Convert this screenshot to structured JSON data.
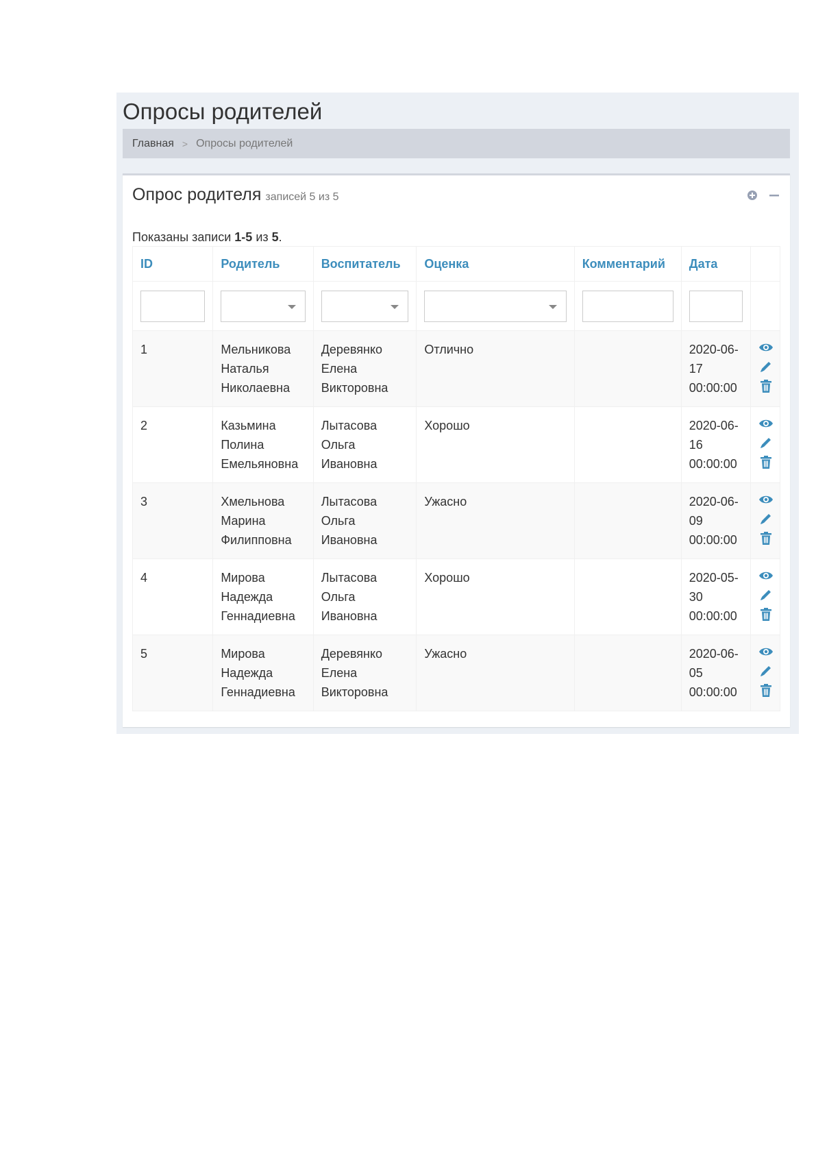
{
  "page_title": "Опросы родителей",
  "breadcrumb": {
    "home": "Главная",
    "separator": ">",
    "current": "Опросы родителей"
  },
  "box": {
    "title": "Опрос родителя",
    "count_text": "записей 5 из 5",
    "tools": [
      "plus-circle-icon",
      "minus-icon"
    ]
  },
  "summary": {
    "prefix": "Показаны записи ",
    "range": "1-5",
    "middle": " из ",
    "total": "5",
    "suffix": "."
  },
  "table": {
    "columns": [
      "ID",
      "Родитель",
      "Воспитатель",
      "Оценка",
      "Комментарий",
      "Дата"
    ],
    "rows": [
      {
        "id": "1",
        "parent": "Мельникова Наталья Николаевна",
        "teacher": "Деревянко Елена Викторовна",
        "rating": "Отлично",
        "comment": "",
        "date": "2020-06-17 00:00:00"
      },
      {
        "id": "2",
        "parent": "Казьмина Полина Емельяновна",
        "teacher": "Лытасова Ольга Ивановна",
        "rating": "Хорошо",
        "comment": "",
        "date": "2020-06-16 00:00:00"
      },
      {
        "id": "3",
        "parent": "Хмельнова Марина Филипповна",
        "teacher": "Лытасова Ольга Ивановна",
        "rating": "Ужасно",
        "comment": "",
        "date": "2020-06-09 00:00:00"
      },
      {
        "id": "4",
        "parent": "Мирова Надежда Геннадиевна",
        "teacher": "Лытасова Ольга Ивановна",
        "rating": "Хорошо",
        "comment": "",
        "date": "2020-05-30 00:00:00"
      },
      {
        "id": "5",
        "parent": "Мирова Надежда Геннадиевна",
        "teacher": "Деревянко Елена Викторовна",
        "rating": "Ужасно",
        "comment": "",
        "date": "2020-06-05 00:00:00"
      }
    ],
    "row_actions": [
      "eye-icon",
      "pencil-icon",
      "trash-icon"
    ]
  },
  "colors": {
    "link": "#3c8dbc",
    "page_bg": "#ecf0f5",
    "breadcrumb_bg": "#d2d6de"
  }
}
